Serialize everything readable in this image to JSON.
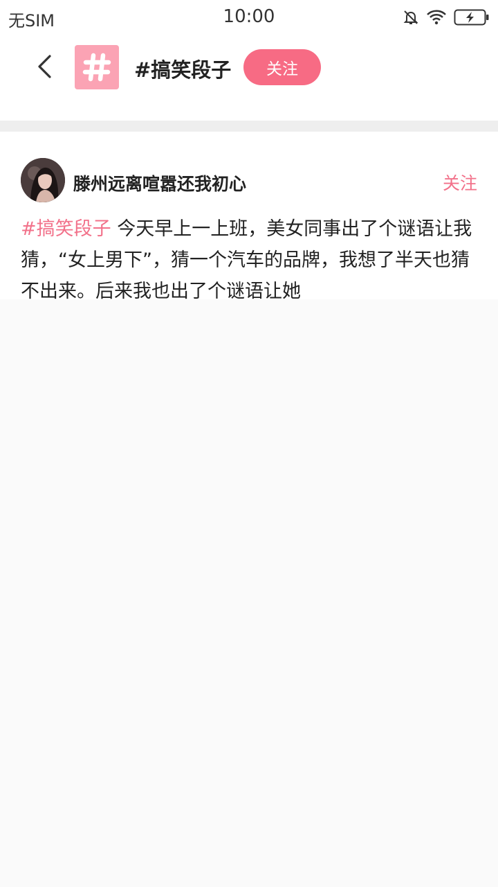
{
  "status_bar": {
    "carrier": "无SIM",
    "time": "10:00",
    "icons": [
      "mute-bell-icon",
      "wifi-icon",
      "battery-charging-icon"
    ]
  },
  "header": {
    "back_icon": "chevron-left-icon",
    "topic_logo_icon": "hashtag-icon",
    "topic_title": "#搞笑段子",
    "follow_label": "关注"
  },
  "colors": {
    "accent": "#f76b84",
    "accent_text": "#f2718a",
    "logo_bg": "#fba3b4",
    "divider": "#eeeeee",
    "page_bg": "#fafafa"
  },
  "post": {
    "author_name": "滕州远离喧嚣还我初心",
    "follow_label": "关注",
    "tag": "#搞笑段子",
    "text": " 今天早上一上班，美女同事出了个谜语让我猜，“女上男下”，猜一个汽车的品牌，我想了半天也猜不出来。后来我也出了个谜语让她"
  }
}
